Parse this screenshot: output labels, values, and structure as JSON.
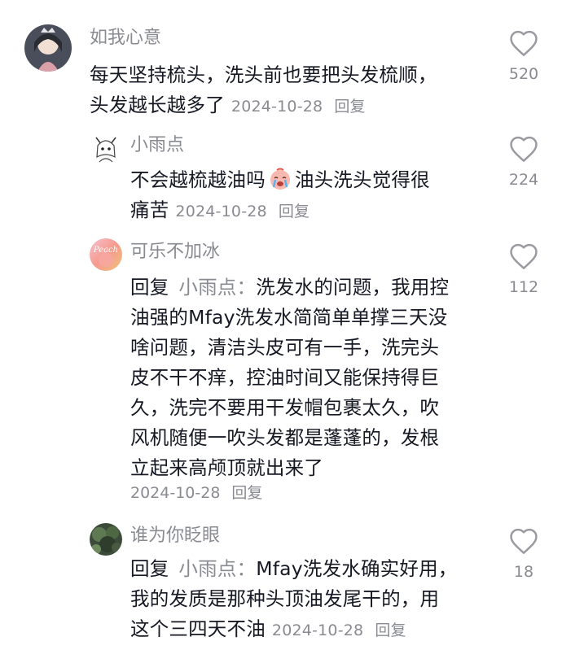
{
  "colors": {
    "text_primary": "#161823",
    "text_secondary": "#8a8b91",
    "heart_stroke": "#9a9aa0"
  },
  "comments": [
    {
      "username": "如我心意",
      "lines": [
        "每天坚持梳头，洗头前也要把头发梳顺，",
        "头发越长越多了"
      ],
      "date": "2024-10-28",
      "reply_label": "回复",
      "like_count": "520",
      "icon": "heart-outline-icon"
    },
    {
      "username": "小雨点",
      "line1_before_emoji": "不会越梳越油吗",
      "emoji_name": "crying-face-emoji",
      "line1_after_emoji": "油头洗头觉得很",
      "line2": "痛苦",
      "date": "2024-10-28",
      "reply_label": "回复",
      "like_count": "224",
      "icon": "heart-outline-icon"
    },
    {
      "username": "可乐不加冰",
      "avatar_text": "Peach",
      "reply_prefix": "回复",
      "reply_target": "小雨点：",
      "line1_text": "洗发水的问题，我用控",
      "lines": [
        "油强的Mfay洗发水简简单单撑三天没",
        "啥问题，清洁头皮可有一手，洗完头",
        "皮不干不痒，控油时间又能保持得巨",
        "久，洗完不要用干发帽包裹太久，吹",
        "风机随便一吹头发都是蓬蓬的，发根",
        "立起来高颅顶就出来了"
      ],
      "date": "2024-10-28",
      "reply_label": "回复",
      "like_count": "112",
      "icon": "heart-outline-icon"
    },
    {
      "username": "谁为你眨眼",
      "reply_prefix": "回复",
      "reply_target": "小雨点：",
      "line1_text": "Mfay洗发水确实好用，",
      "lines": [
        "我的发质是那种头顶油发尾干的，用",
        "这个三四天不油"
      ],
      "date": "2024-10-28",
      "reply_label": "回复",
      "like_count": "18",
      "icon": "heart-outline-icon"
    }
  ]
}
